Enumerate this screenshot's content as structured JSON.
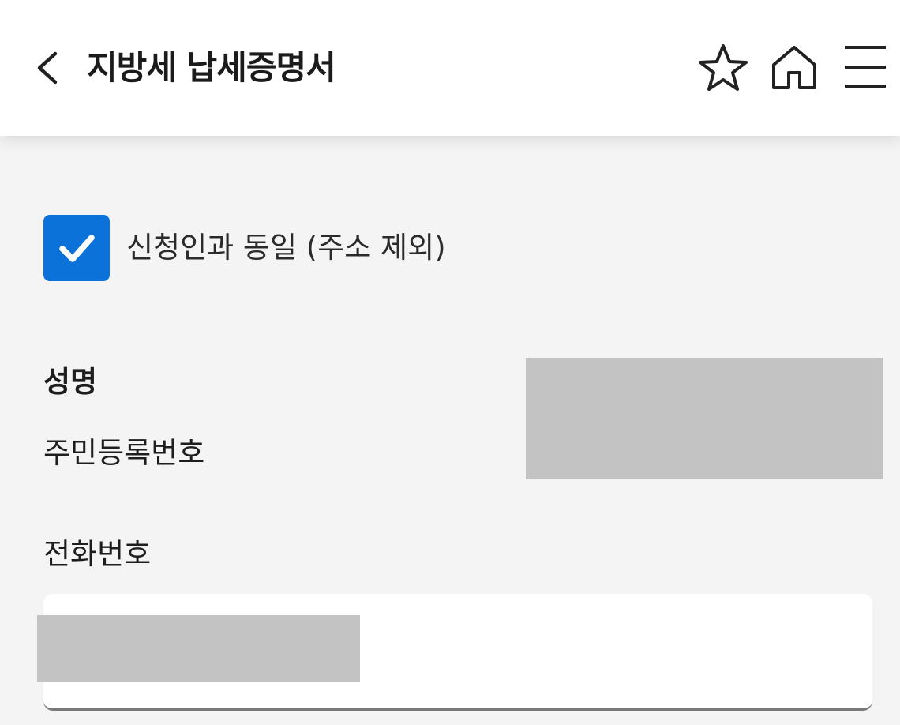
{
  "header": {
    "title": "지방세 납세증명서",
    "icons": {
      "back": "chevron-left-icon",
      "favorite": "star-icon",
      "home": "home-icon",
      "menu": "hamburger-menu-icon"
    }
  },
  "form": {
    "same_as_applicant": {
      "label": "신청인과 동일 (주소 제외)",
      "checked": true
    },
    "name_label": "성명",
    "rrn_label": "주민등록번호",
    "phone_label": "전화번호"
  },
  "colors": {
    "accent": "#0b72d9",
    "background": "#f4f4f4",
    "redaction": "#c3c3c3"
  }
}
